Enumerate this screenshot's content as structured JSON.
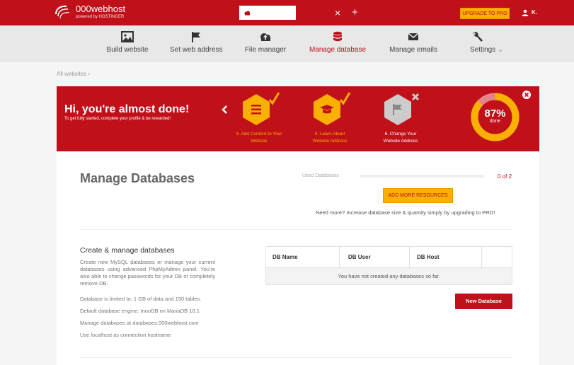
{
  "header": {
    "brand": "000webhost",
    "brand_sub": "powered by HOSTINGER",
    "upgrade_label": "UPGRADE TO PRO",
    "user_name": "K."
  },
  "nav": {
    "items": [
      {
        "label": "Build website",
        "icon": "image-icon"
      },
      {
        "label": "Set web address",
        "icon": "flag-icon"
      },
      {
        "label": "File manager",
        "icon": "cloud-upload-icon"
      },
      {
        "label": "Manage database",
        "icon": "database-icon",
        "active": true
      },
      {
        "label": "Manage emails",
        "icon": "envelope-icon"
      },
      {
        "label": "Settings",
        "icon": "wrench-icon"
      }
    ],
    "settings_caret": "⌄"
  },
  "breadcrumb": "All websites  ›",
  "banner": {
    "title": "Hi, you're almost done!",
    "subtitle": "To get fully started, complete your profile & be rewarded!",
    "steps": [
      {
        "label_1": "4. Add Content to Your",
        "label_2": "Website",
        "status": "done",
        "icon": "list-icon"
      },
      {
        "label_1": "5. Learn About",
        "label_2": "Website Address",
        "status": "done",
        "icon": "graduation-cap-icon"
      },
      {
        "label_1": "6. Change Your",
        "label_2": "Website Address",
        "status": "todo",
        "icon": "flag-icon"
      }
    ],
    "progress_pct": "87%",
    "progress_word": "done",
    "progress_value": 0.87,
    "colors": {
      "red": "#c0101a",
      "yellow": "#f9b000",
      "grey": "#cccccc"
    }
  },
  "main": {
    "title": "Manage Databases",
    "used_label": "Used Databases",
    "used_count": "0 of 2",
    "used_fraction": 0,
    "add_resources_label": "ADD MORE RESOURCES",
    "need_more": "Need more? Increase database size & quantity simply by upgrading to PRO!",
    "section_title": "Create & manage databases",
    "section_desc": "Create new MySQL databases or manage your current databases using advanced PhpMyAdmin panel. You're also able to change passwords for your DB or completely remove DB.",
    "info_lines": [
      "Database is limited to: 1 GB of data and 150 tables.",
      "Default database engine: InnoDB on MariaDB 10.1",
      "Manage databases at databases.000webhost.com",
      "Use localhost as connection hostname"
    ],
    "table": {
      "columns": [
        "DB Name",
        "DB User",
        "DB Host",
        ""
      ],
      "empty_text": "You have not created any databases so far."
    },
    "new_db_label": "New Database"
  }
}
